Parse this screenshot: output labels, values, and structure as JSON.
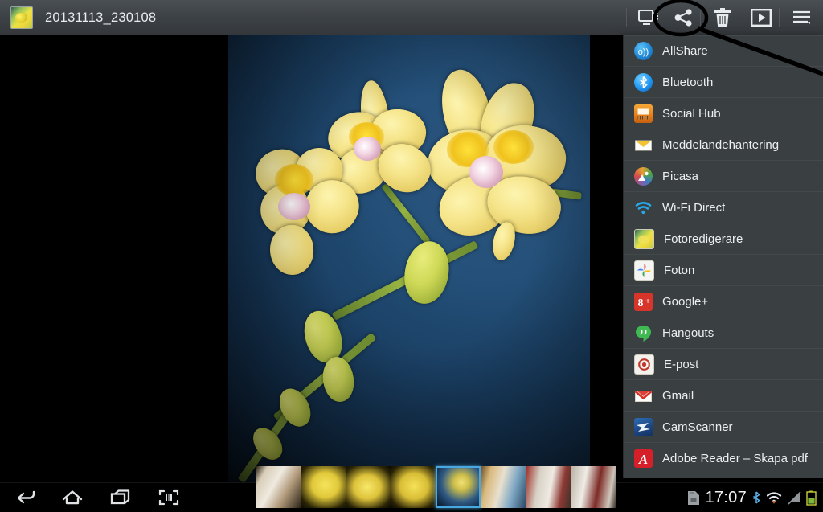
{
  "titlebar": {
    "title": "20131113_230108",
    "app_icon": "photo-thumbnail-icon",
    "actions": [
      {
        "name": "screen-mirroring-icon",
        "label": "Screen mirroring"
      },
      {
        "name": "share-icon",
        "label": "Share"
      },
      {
        "name": "delete-icon",
        "label": "Delete"
      },
      {
        "name": "slideshow-icon",
        "label": "Slideshow"
      },
      {
        "name": "menu-icon",
        "label": "More options"
      }
    ]
  },
  "share_menu": {
    "items": [
      {
        "label": "AllShare",
        "icon": "allshare-icon",
        "color": "#1e7fd4"
      },
      {
        "label": "Bluetooth",
        "icon": "bluetooth-icon",
        "color": "#2196f3"
      },
      {
        "label": "Social Hub",
        "icon": "social-hub-icon",
        "color": "#e8841d"
      },
      {
        "label": "Meddelandehantering",
        "icon": "messaging-icon",
        "color": "#f2c233"
      },
      {
        "label": "Picasa",
        "icon": "picasa-icon",
        "color": "#8a5ba6"
      },
      {
        "label": "Wi-Fi Direct",
        "icon": "wifi-direct-icon",
        "color": "#29a7e8"
      },
      {
        "label": "Fotoredigerare",
        "icon": "photo-editor-icon",
        "color": "#d7c33a"
      },
      {
        "label": "Foton",
        "icon": "google-photos-icon",
        "color": "#d93025"
      },
      {
        "label": "Google+",
        "icon": "google-plus-icon",
        "color": "#d7342a"
      },
      {
        "label": "Hangouts",
        "icon": "hangouts-icon",
        "color": "#3fba52"
      },
      {
        "label": "E-post",
        "icon": "email-icon",
        "color": "#c0392b"
      },
      {
        "label": "Gmail",
        "icon": "gmail-icon",
        "color": "#d93025"
      },
      {
        "label": "CamScanner",
        "icon": "camscanner-icon",
        "color": "#1e4f93"
      },
      {
        "label": "Adobe Reader – Skapa pdf",
        "icon": "adobe-reader-icon",
        "color": "#d5202a"
      }
    ]
  },
  "photo": {
    "subject": "Yellow orchid flowers on blue background",
    "background_color": "#24507a"
  },
  "filmstrip": {
    "selected_index": 4,
    "thumbnails": [
      {
        "name": "thumb-room-1"
      },
      {
        "name": "thumb-orchid-1"
      },
      {
        "name": "thumb-orchid-2"
      },
      {
        "name": "thumb-orchid-3"
      },
      {
        "name": "thumb-orchid-blue-selected"
      },
      {
        "name": "thumb-window-1"
      },
      {
        "name": "thumb-meeting-1"
      }
    ]
  },
  "annotation": {
    "circle_target": "share-icon",
    "color": "#000000"
  },
  "navbar": {
    "buttons": [
      {
        "name": "back-button",
        "label": "Back"
      },
      {
        "name": "home-button",
        "label": "Home"
      },
      {
        "name": "recents-button",
        "label": "Recent apps"
      },
      {
        "name": "screenshot-button",
        "label": "Screen capture"
      }
    ]
  },
  "statusbar": {
    "time": "17:07",
    "icons": [
      {
        "name": "sd-card-icon"
      },
      {
        "name": "bluetooth-status-icon"
      },
      {
        "name": "wifi-status-icon"
      },
      {
        "name": "signal-status-icon"
      },
      {
        "name": "battery-status-icon"
      }
    ]
  }
}
